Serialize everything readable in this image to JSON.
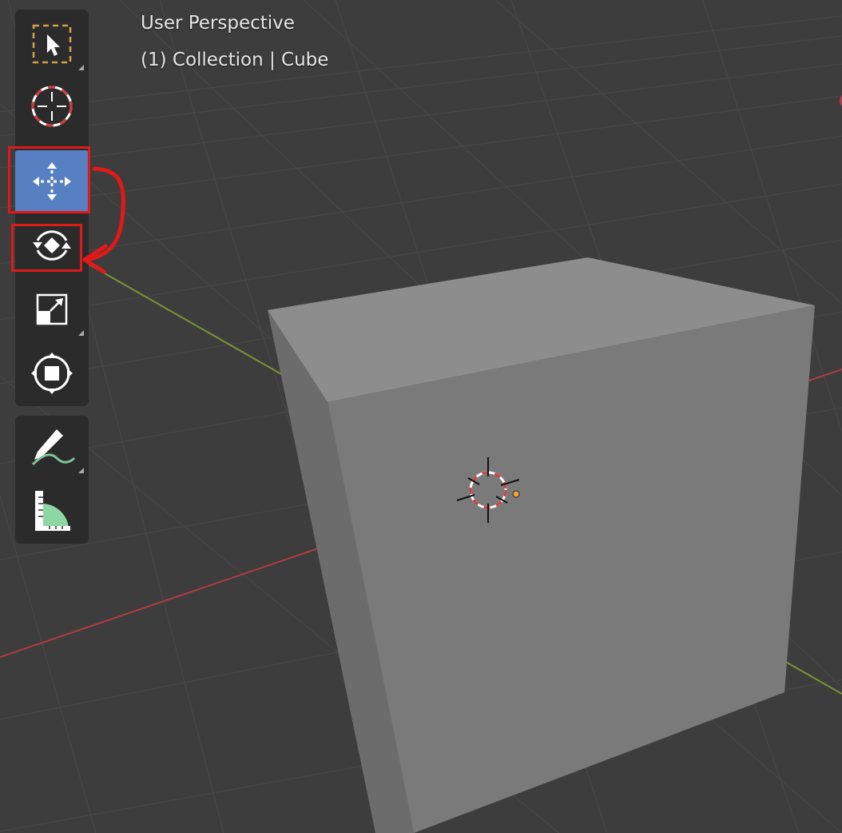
{
  "viewport": {
    "view_name": "User Perspective",
    "view_info": "(1) Collection | Cube"
  },
  "toolbar": {
    "tools": [
      {
        "id": "select-box",
        "icon": "select-box-icon",
        "active": false,
        "has_submenu": true
      },
      {
        "id": "cursor",
        "icon": "cursor-icon",
        "active": false,
        "has_submenu": false
      },
      {
        "id": "move",
        "icon": "move-icon",
        "active": true,
        "has_submenu": false
      },
      {
        "id": "rotate",
        "icon": "rotate-icon",
        "active": false,
        "has_submenu": false
      },
      {
        "id": "scale",
        "icon": "scale-icon",
        "active": false,
        "has_submenu": true
      },
      {
        "id": "transform",
        "icon": "transform-icon",
        "active": false,
        "has_submenu": false
      },
      {
        "id": "annotate",
        "icon": "annotate-icon",
        "active": false,
        "has_submenu": true
      },
      {
        "id": "measure",
        "icon": "measure-icon",
        "active": false,
        "has_submenu": false
      }
    ]
  },
  "annotation": {
    "highlight_color": "#e01919",
    "from_tool": "move",
    "to_tool": "rotate"
  },
  "colors": {
    "background": "#3d3d3d",
    "toolbar": "#2b2b2b",
    "active_tool": "#5680c2",
    "x_axis": "#b13c44",
    "y_axis": "#7a9433",
    "cube_top": "#8d8d8d",
    "cube_front": "#7a7a7a",
    "cube_left": "#6c6c6c"
  }
}
